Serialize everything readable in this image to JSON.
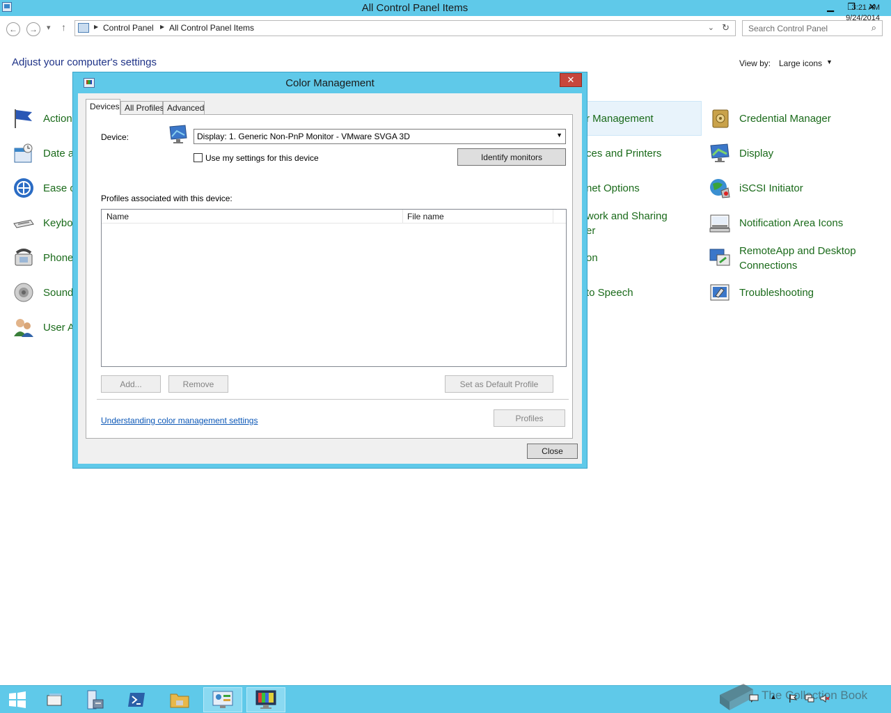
{
  "window": {
    "title": "All Control Panel Items",
    "controls": [
      "▁",
      "❐",
      "✕"
    ]
  },
  "address_bar": {
    "breadcrumbs": [
      "Control Panel",
      "All Control Panel Items"
    ],
    "search_placeholder": "Search Control Panel"
  },
  "page": {
    "heading": "Adjust your computer's settings",
    "view_by_label": "View by:",
    "view_by_value": "Large icons"
  },
  "items_left": [
    {
      "label": "Action",
      "icon": "flag-icon"
    },
    {
      "label": "Date a",
      "icon": "calendar-icon"
    },
    {
      "label": "Ease o",
      "icon": "ease-of-access-icon"
    },
    {
      "label": "Keybo",
      "icon": "keyboard-icon"
    },
    {
      "label": "Phone",
      "icon": "phone-icon"
    },
    {
      "label": "Sound",
      "icon": "speaker-icon"
    },
    {
      "label": "User A",
      "icon": "users-icon"
    }
  ],
  "items_middle": [
    {
      "label": "r Management"
    },
    {
      "label": "ces and Printers"
    },
    {
      "label": "net Options"
    },
    {
      "label": "work and Sharing",
      "label2": "er"
    },
    {
      "label": "on"
    },
    {
      "label": "to Speech"
    }
  ],
  "items_right": [
    {
      "label": "Credential Manager",
      "icon": "vault-icon"
    },
    {
      "label": "Display",
      "icon": "display-icon"
    },
    {
      "label": "iSCSI Initiator",
      "icon": "globe-icon"
    },
    {
      "label": "Notification Area Icons",
      "icon": "notification-icon"
    },
    {
      "label": "RemoteApp and Desktop",
      "label2": "Connections",
      "icon": "remoteapp-icon"
    },
    {
      "label": "Troubleshooting",
      "icon": "troubleshooting-icon"
    }
  ],
  "dialog": {
    "title": "Color Management",
    "close_glyph": "✕",
    "tabs": [
      "Devices",
      "All Profiles",
      "Advanced"
    ],
    "device_label": "Device:",
    "device_value": "Display: 1. Generic Non-PnP Monitor - VMware SVGA 3D",
    "use_settings_label": "Use my settings for this device",
    "use_settings_checked": false,
    "identify_button": "Identify monitors",
    "profiles_label": "Profiles associated with this device:",
    "columns": [
      "Name",
      "File name"
    ],
    "profiles": [],
    "add_button": "Add...",
    "remove_button": "Remove",
    "set_default_button": "Set as Default Profile",
    "link": "Understanding color management settings",
    "profiles_button": "Profiles",
    "close_button": "Close"
  },
  "taskbar": {
    "time": "3:21 AM",
    "date": "9/24/2014",
    "watermark": "The Collection Book"
  },
  "colors": {
    "titlebar": "#5fc9e9",
    "link_green": "#1a6a1a",
    "heading_blue": "#1e3287",
    "close_red": "#c7463c"
  }
}
